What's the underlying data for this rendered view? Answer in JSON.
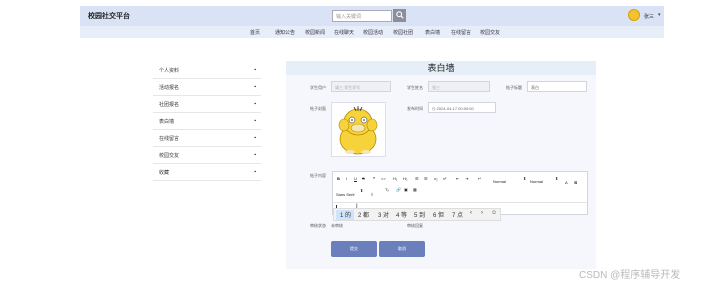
{
  "header": {
    "logo": "校园社交平台",
    "search_placeholder": "输入关键词",
    "search_icon": "search-icon",
    "username": "张三",
    "user_caret": "▾"
  },
  "nav": {
    "items": [
      "首页",
      "通知公告",
      "校园新闻",
      "在线聊天",
      "校园活动",
      "校园社团",
      "表白墙",
      "在线留言",
      "校园交友"
    ]
  },
  "sidebar": {
    "items": [
      {
        "label": "个人资料"
      },
      {
        "label": "活动报名"
      },
      {
        "label": "社团报名"
      },
      {
        "label": "表白墙"
      },
      {
        "label": "在线留言"
      },
      {
        "label": "校园交友"
      },
      {
        "label": "收藏"
      }
    ],
    "arrow": "▪"
  },
  "form": {
    "title": "表白墙",
    "fields": {
      "student_account_label": "学生用户",
      "student_account_value": "请三 学生学号",
      "student_name_label": "学生姓名",
      "student_name_value": "张三",
      "post_title_label": "帖子标题",
      "post_title_value": "表白",
      "post_image_label": "帖子封面",
      "publish_time_label": "发布时间",
      "publish_time_value": "2024-04-17 00:00:00",
      "post_content_label": "帖子内容",
      "review_status_label": "审核状态",
      "review_status_value": "未审核",
      "review_reply_label": "审核回复"
    },
    "editor": {
      "toolbar_row1": [
        "B",
        "I",
        "U",
        "S",
        "❝",
        "<>",
        "H₁",
        "H₂",
        "☰",
        "☰",
        "x₂",
        "x²",
        "⇤",
        "⇥",
        "↵",
        "Normal",
        "⬍",
        "Normal",
        "⬍",
        "A",
        "⊠"
      ],
      "toolbar_row2": [
        "Sans Serif",
        "⬍",
        "≡",
        "Tₓ",
        "🔗",
        "▣",
        "▦"
      ],
      "ime_candidates": [
        "1 的",
        "2 都",
        "3 对",
        "4 等",
        "5 到",
        "6 但",
        "7 点"
      ],
      "ime_controls": [
        "‹",
        "›",
        "☺"
      ]
    },
    "buttons": {
      "submit": "提交",
      "cancel": "取消"
    }
  },
  "watermark": "CSDN @程序辅导开发",
  "colors": {
    "header_bg": "#d9e3f5",
    "button": "#6b7fbd",
    "panel": "#f5f7fc"
  }
}
